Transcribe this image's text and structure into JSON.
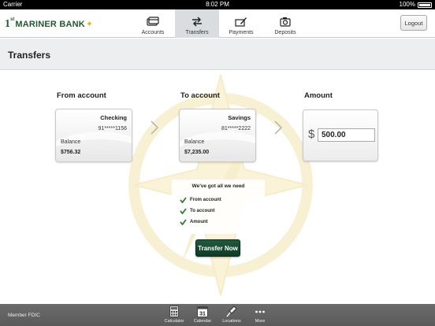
{
  "status_bar": {
    "carrier": "Carrier",
    "time": "8:02 PM",
    "battery": "100%"
  },
  "brand": {
    "logo_one": "1",
    "logo_st": "st",
    "logo_name": "MARINER BANK"
  },
  "nav": {
    "tabs": [
      {
        "label": "Accounts",
        "icon": "accounts-card-icon"
      },
      {
        "label": "Transfers",
        "icon": "transfer-arrows-icon",
        "active": true
      },
      {
        "label": "Payments",
        "icon": "payment-pen-icon"
      },
      {
        "label": "Deposits",
        "icon": "camera-icon"
      }
    ],
    "logout_label": "Logout"
  },
  "page": {
    "title": "Transfers"
  },
  "transfer": {
    "from_label": "From account",
    "to_label": "To account",
    "amount_label": "Amount",
    "from_account": {
      "name": "Checking",
      "number": "91*****1156",
      "balance_label": "Balance",
      "balance": "$756.32"
    },
    "to_account": {
      "name": "Savings",
      "number": "81*****2222",
      "balance_label": "Balance",
      "balance": "$7,235.00"
    },
    "currency_symbol": "$",
    "amount_value": "500.00",
    "checklist": {
      "title": "We've got all we need",
      "items": [
        "From account",
        "To account",
        "Amount"
      ]
    },
    "submit_label": "Transfer Now"
  },
  "footer": {
    "fdic": "Member FDIC",
    "calendar_day": "31",
    "tools": [
      {
        "label": "Calculator",
        "icon": "calculator-icon"
      },
      {
        "label": "Calendar",
        "icon": "calendar-icon"
      },
      {
        "label": "Locations",
        "icon": "location-pin-icon"
      },
      {
        "label": "More",
        "icon": "more-dots-icon"
      }
    ]
  },
  "colors": {
    "brand_green": "#1e5a2f",
    "accent_gold": "#e0b820",
    "check_green": "#2e7d32"
  }
}
